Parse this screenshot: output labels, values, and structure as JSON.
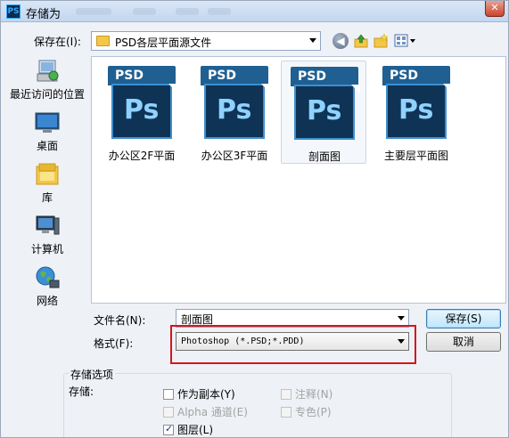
{
  "window": {
    "title": "存储为",
    "app_icon": "PS",
    "close_icon": "close-icon"
  },
  "save_in": {
    "label": "保存在(I):",
    "current_folder": "PSD各层平面源文件",
    "icons": [
      "back-icon",
      "up-folder-icon",
      "new-folder-icon",
      "views-menu-icon"
    ]
  },
  "places": [
    {
      "label": "最近访问的位置",
      "icon": "recent-places-icon"
    },
    {
      "label": "桌面",
      "icon": "desktop-icon"
    },
    {
      "label": "库",
      "icon": "libraries-icon"
    },
    {
      "label": "计算机",
      "icon": "computer-icon"
    },
    {
      "label": "网络",
      "icon": "network-icon"
    }
  ],
  "files": [
    {
      "name": "办公区2F平面",
      "icon_text": "PSD",
      "icon_mark": "Ps"
    },
    {
      "name": "办公区3F平面",
      "icon_text": "PSD",
      "icon_mark": "Ps"
    },
    {
      "name": "剖面图",
      "icon_text": "PSD",
      "icon_mark": "Ps",
      "selected": true
    },
    {
      "name": "主要层平面图",
      "icon_text": "PSD",
      "icon_mark": "Ps"
    }
  ],
  "filename": {
    "label": "文件名(N):",
    "value": "剖面图"
  },
  "format": {
    "label": "格式(F):",
    "value": "Photoshop (*.PSD;*.PDD)"
  },
  "buttons": {
    "save": "保存(S)",
    "cancel": "取消"
  },
  "save_options": {
    "group_title": "存储选项",
    "save_label": "存储:",
    "as_copy": "作为副本(Y)",
    "notes": "注释(N)",
    "alpha": "Alpha 通道(E)",
    "spot": "专色(P)",
    "layers": "图层(L)"
  },
  "colors": {
    "highlight": "#d0181e",
    "accent": "#3c7fb1"
  }
}
